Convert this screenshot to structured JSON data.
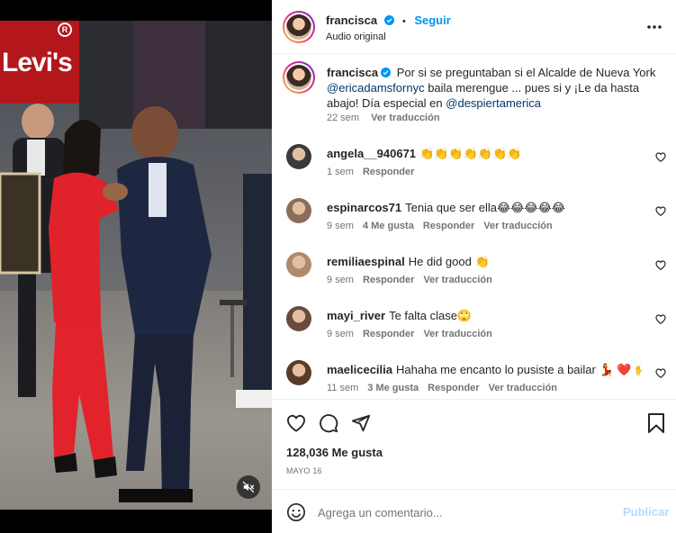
{
  "video": {
    "sign_text": "Levi's",
    "sign_mark": "R",
    "mute_icon": "speaker-muted-icon"
  },
  "post": {
    "author": "francisca",
    "follow_separator": "•",
    "follow_label": "Seguir",
    "audio_label": "Audio original",
    "more_icon": "more-options-icon"
  },
  "caption": {
    "author": "francisca",
    "line1": "Por si se preguntaban si el Alcalde de Nueva York",
    "mention": "@ericadamsfornyc",
    "line2_rest": " baila merengue ... pues si y ¡Le da hasta",
    "line3": "abajo! Día especial en ",
    "mention2": "@despiertamerica",
    "time": "22 sem",
    "translate": "Ver traducción"
  },
  "comments": [
    {
      "user": "angela__940671",
      "text": "👏👏👏👏👏👏👏",
      "time": "1 sem",
      "likes": "",
      "reply": "Responder",
      "translate": ""
    },
    {
      "user": "espinarcos71",
      "text": "Tenia que ser ella😂😂😂😂😂",
      "time": "9 sem",
      "likes": "4 Me gusta",
      "reply": "Responder",
      "translate": "Ver traducción"
    },
    {
      "user": "remiliaespinal",
      "text": "He did good 👏",
      "time": "9 sem",
      "likes": "",
      "reply": "Responder",
      "translate": "Ver traducción"
    },
    {
      "user": "mayi_river",
      "text": "Te falta clase🙄",
      "time": "9 sem",
      "likes": "",
      "reply": "Responder",
      "translate": "Ver traducción"
    },
    {
      "user": "maelicecilia",
      "text": "Hahaha me encanto lo pusiste a bailar 💃 ❤️ 🙌🔥",
      "time": "11 sem",
      "likes": "3 Me gusta",
      "reply": "Responder",
      "translate": "Ver traducción"
    }
  ],
  "actions": {
    "like_icon": "heart-icon",
    "comment_icon": "comment-icon",
    "share_icon": "share-icon",
    "save_icon": "bookmark-icon",
    "likes_count": "128,036 Me gusta",
    "date": "MAYO 16"
  },
  "composer": {
    "emoji_icon": "emoji-icon",
    "placeholder": "Agrega un comentario...",
    "publish_label": "Publicar"
  },
  "colors": {
    "accent": "#0095f6",
    "publish_disabled": "#b3dbff",
    "link": "#00376b",
    "text": "#262626",
    "muted": "#737373"
  }
}
